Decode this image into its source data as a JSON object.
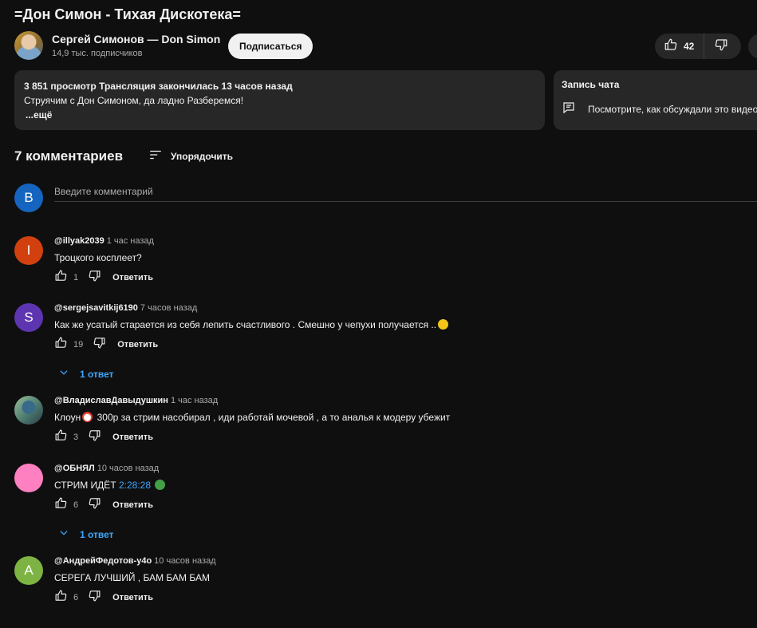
{
  "video": {
    "title": "=Дон Симон - Тихая Дискотека="
  },
  "channel": {
    "name": "Сергей Симонов — Don Simon",
    "subscribers": "14,9 тыс. подписчиков",
    "subscribe_label": "Подписаться",
    "like_count": "42"
  },
  "description": {
    "meta": "3 851 просмотр  Трансляция закончилась 13 часов назад",
    "text": "Струячим с Дон Симоном, да ладно  Разберемся!",
    "more": "...ещё"
  },
  "chat_replay": {
    "title": "Запись чата",
    "text": "Посмотрите, как обсуждали это видео"
  },
  "comments_header": {
    "count": "7 комментариев",
    "sort_label": "Упорядочить"
  },
  "comment_box": {
    "avatar_letter": "В",
    "placeholder": "Введите комментарий"
  },
  "colors": {
    "accent_link": "#3ea6ff",
    "my_avatar": "#1565c0"
  },
  "comments": [
    {
      "author": "@illyak2039",
      "time": "1 час назад",
      "avatar_letter": "I",
      "avatar_color": "#d2400f",
      "text": "Троцкого косплеет?",
      "likes": "1",
      "reply_label": "Ответить"
    },
    {
      "author": "@sergejsavitkij6190",
      "time": "7 часов назад",
      "avatar_letter": "S",
      "avatar_color": "#5e35b1",
      "text": "Как же усатый  старается  из себя  лепить  счастливого  . Смешно  у чепухи  получается  ..",
      "emoji": "grinning-sweat-emoji",
      "likes": "19",
      "reply_label": "Ответить",
      "replies_label": "1 ответ"
    },
    {
      "author": "@ВладиславДавыдушкин",
      "time": "1 час назад",
      "avatar_letter": "",
      "avatar_color": "#6b8e7d",
      "text_before": "Клоун",
      "emoji": "clown-emoji",
      "text_after": " 300р за стрим насобирал , иди работай мочевой , а то аналья к модеру убежит",
      "likes": "3",
      "reply_label": "Ответить"
    },
    {
      "author": "@ОБНЯЛ",
      "time": "10 часов назад",
      "avatar_letter": "",
      "avatar_color": "#ff80c0",
      "text": "СТРИМ ИДЁТ ",
      "timestamp": "2:28:28",
      "emoji": "green-circle-emoji",
      "likes": "6",
      "reply_label": "Ответить",
      "replies_label": "1 ответ"
    },
    {
      "author": "@АндрейФедотов-у4о",
      "time": "10 часов назад",
      "avatar_letter": "А",
      "avatar_color": "#7cb342",
      "text": "СЕРЕГА ЛУЧШИЙ , БАМ БАМ БАМ",
      "likes": "6",
      "reply_label": "Ответить"
    }
  ]
}
